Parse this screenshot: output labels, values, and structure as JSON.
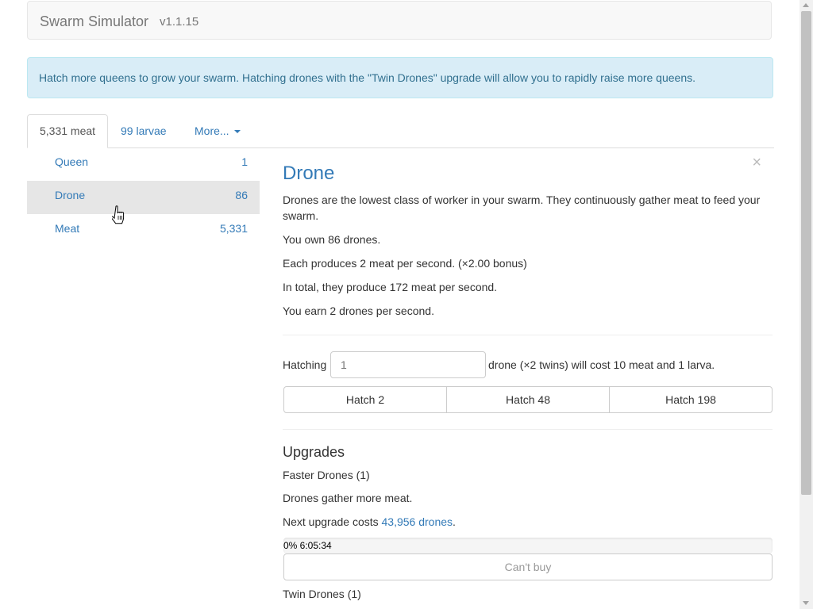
{
  "app": {
    "title": "Swarm Simulator",
    "version": "v1.1.15"
  },
  "alert": {
    "text": "Hatch more queens to grow your swarm. Hatching drones with the \"Twin Drones\" upgrade will allow you to rapidly raise more queens."
  },
  "tabs": [
    {
      "label": "5,331 meat",
      "active": true
    },
    {
      "label": "99 larvae",
      "active": false
    },
    {
      "label": "More...",
      "active": false
    }
  ],
  "units": [
    {
      "name": "Queen",
      "count": "1",
      "selected": false
    },
    {
      "name": "Drone",
      "count": "86",
      "selected": true
    },
    {
      "name": "Meat",
      "count": "5,331",
      "selected": false
    }
  ],
  "detail": {
    "title": "Drone",
    "close_symbol": "×",
    "description": "Drones are the lowest class of worker in your swarm. They continuously gather meat to feed your swarm.",
    "owned": "You own 86 drones.",
    "production": "Each produces 2 meat per second. (×2.00 bonus)",
    "total": "In total, they produce 172 meat per second.",
    "earn": "You earn 2 drones per second.",
    "hatch": {
      "prefix": "Hatching",
      "input_placeholder": "1",
      "suffix": "drone (×2 twins) will cost 10 meat and 1 larva.",
      "buttons": [
        "Hatch 2",
        "Hatch 48",
        "Hatch 198"
      ]
    },
    "upgrades": {
      "heading": "Upgrades",
      "items": [
        {
          "name": "Faster Drones (1)",
          "description": "Drones gather more meat.",
          "cost_prefix": "Next upgrade costs",
          "cost_link": "43,956 drones",
          "cost_suffix": ".",
          "progress_text": "0% 6:05:34",
          "progress_value": 0,
          "button": "Can't buy"
        },
        {
          "name": "Twin Drones (1)"
        }
      ]
    }
  },
  "colors": {
    "link": "#337ab7",
    "alert_bg": "#d9edf7",
    "alert_text": "#31708f",
    "selected_row": "#e6e6e6"
  },
  "icons": {
    "close": "close-icon",
    "dropdown": "caret-down-icon",
    "cursor": "hand-pointer-icon"
  }
}
